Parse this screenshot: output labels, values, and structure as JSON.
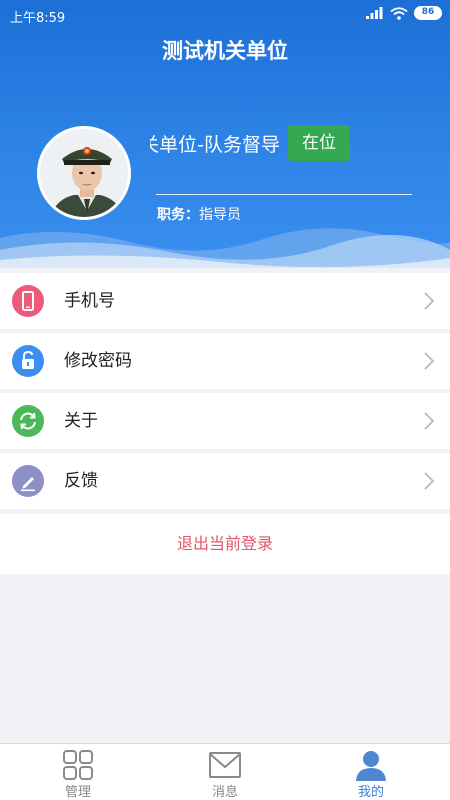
{
  "status_bar": {
    "time": "上午8:59",
    "battery": "86"
  },
  "header": {
    "title": "测试机关单位"
  },
  "profile": {
    "unit_name": "测试机关单位-队务督导",
    "status_button": "在位",
    "duty_label": "职务：",
    "duty_value": "指导员"
  },
  "menu": {
    "items": [
      {
        "label": "手机号",
        "icon": "phone-icon",
        "color": "#ee5a79"
      },
      {
        "label": "修改密码",
        "icon": "lock-icon",
        "color": "#3a8ff0"
      },
      {
        "label": "关于",
        "icon": "refresh-icon",
        "color": "#4cb857"
      },
      {
        "label": "反馈",
        "icon": "pencil-icon",
        "color": "#8d8fc7"
      }
    ]
  },
  "logout": {
    "label": "退出当前登录",
    "color": "#e2566e"
  },
  "tabbar": {
    "tabs": [
      {
        "label": "管理",
        "icon": "grid-icon"
      },
      {
        "label": "消息",
        "icon": "mail-icon"
      },
      {
        "label": "我的",
        "icon": "person-icon",
        "active": true
      }
    ]
  }
}
